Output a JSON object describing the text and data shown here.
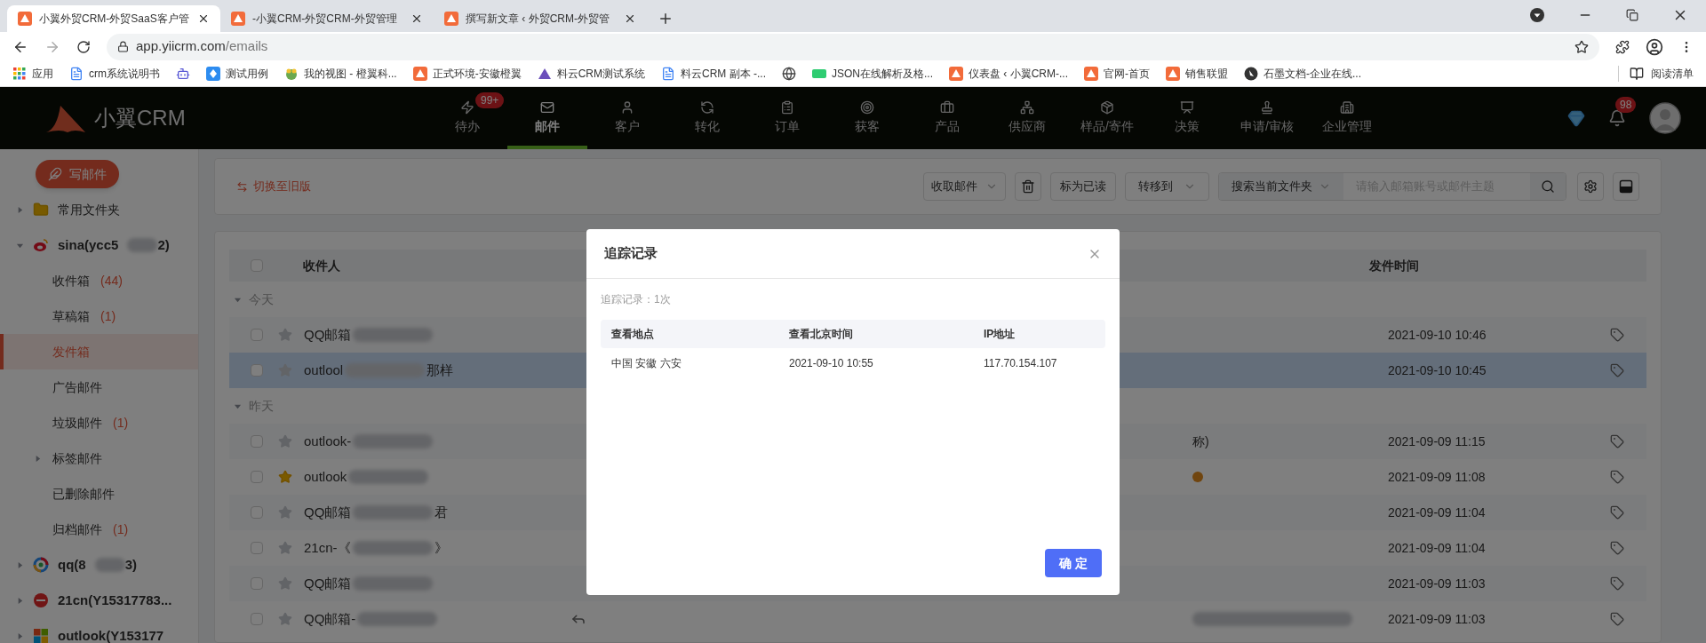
{
  "browser": {
    "tabs": [
      {
        "title": "小翼外贸CRM-外贸SaaS客户管",
        "selected": true
      },
      {
        "title": "-小翼CRM-外贸CRM-外贸管理",
        "selected": false
      },
      {
        "title": "撰写新文章 ‹ 外贸CRM-外贸管",
        "selected": false
      }
    ],
    "url_host": "app.yiicrm.com",
    "url_path": "/emails",
    "bookmarks": [
      {
        "kind": "apps",
        "label": "应用"
      },
      {
        "kind": "doc",
        "label": "crm系统说明书"
      },
      {
        "kind": "bot"
      },
      {
        "kind": "diamond",
        "label": "测试用例"
      },
      {
        "kind": "frog",
        "label": "我的视图 - 橙翼科..."
      },
      {
        "kind": "crm",
        "label": "正式环境-安徽橙翼"
      },
      {
        "kind": "triangle",
        "label": "料云CRM测试系统"
      },
      {
        "kind": "doc",
        "label": "料云CRM 副本 -..."
      },
      {
        "kind": "globe"
      },
      {
        "kind": "json",
        "label": "JSON在线解析及格..."
      },
      {
        "kind": "crm",
        "label": "仪表盘 ‹ 小翼CRM-..."
      },
      {
        "kind": "crm",
        "label": "官网-首页"
      },
      {
        "kind": "crm",
        "label": "销售联盟"
      },
      {
        "kind": "pen",
        "label": "石墨文档-企业在线..."
      }
    ],
    "reading_list": "阅读清单"
  },
  "app": {
    "logo": "小翼CRM",
    "nav": [
      {
        "label": "待办",
        "selected": false,
        "badge": "99+"
      },
      {
        "label": "邮件",
        "selected": true
      },
      {
        "label": "客户",
        "selected": false
      },
      {
        "label": "转化",
        "selected": false
      },
      {
        "label": "订单",
        "selected": false
      },
      {
        "label": "获客",
        "selected": false
      },
      {
        "label": "产品",
        "selected": false
      },
      {
        "label": "供应商",
        "selected": false
      },
      {
        "label": "样品/寄件",
        "selected": false
      },
      {
        "label": "决策",
        "selected": false
      },
      {
        "label": "申请/审核",
        "selected": false
      },
      {
        "label": "企业管理",
        "selected": false
      }
    ],
    "notifications": "98"
  },
  "sidebar": {
    "compose": "写邮件",
    "items": [
      {
        "kind": "folder",
        "label": "常用文件夹",
        "expanded": false
      },
      {
        "kind": "weibo",
        "label": "sina(ycc5",
        "tail": "2)",
        "expanded": true,
        "children": [
          {
            "label": "收件箱",
            "count": "(44)",
            "selected": false
          },
          {
            "label": "草稿箱",
            "count": "(1)",
            "selected": false
          },
          {
            "label": "发件箱",
            "selected": true
          },
          {
            "label": "广告邮件",
            "selected": false
          },
          {
            "label": "垃圾邮件",
            "count": "(1)",
            "selected": false
          },
          {
            "label": "标签邮件",
            "selected": false,
            "expanded": false
          },
          {
            "label": "已删除邮件",
            "selected": false
          },
          {
            "label": "归档邮件",
            "count": "(1)",
            "selected": false
          }
        ]
      },
      {
        "kind": "ring",
        "label": "qq(8",
        "tail": "3)",
        "expanded": false
      },
      {
        "kind": "disc",
        "label": "21cn(Y15317783...",
        "expanded": false
      },
      {
        "kind": "windows",
        "label": "outlook(Y153177",
        "expanded": false
      }
    ]
  },
  "toolbar": {
    "switch_link": "切换至旧版",
    "fetch": "收取邮件",
    "mark_read": "标为已读",
    "move_to": "转移到",
    "search_scope": "搜索当前文件夹",
    "search_placeholder": "请输入邮箱账号或邮件主题"
  },
  "table": {
    "columns": [
      "收件人",
      "发件时间"
    ],
    "all_checked": false,
    "groups": [
      {
        "label": "今天",
        "expanded": true,
        "rows": [
          {
            "recipient": "QQ邮箱",
            "checked": false,
            "starred": false,
            "selected": false,
            "time": "2021-09-10 10:46"
          },
          {
            "recipient": "outlool",
            "tail": "那样",
            "checked": false,
            "starred": false,
            "selected": true,
            "time": "2021-09-10 10:45"
          }
        ]
      },
      {
        "label": "昨天",
        "expanded": true,
        "rows": [
          {
            "recipient": "outlook-",
            "subject": "称)",
            "checked": false,
            "starred": false,
            "selected": false,
            "time": "2021-09-09 11:15"
          },
          {
            "recipient": "outlook",
            "checked": false,
            "starred": true,
            "selected": false,
            "dot": true,
            "time": "2021-09-09 11:08"
          },
          {
            "recipient": "QQ邮箱",
            "tail": "君",
            "checked": false,
            "starred": false,
            "selected": false,
            "time": "2021-09-09 11:04"
          },
          {
            "recipient": "21cn-《",
            "tail": "》",
            "checked": false,
            "starred": false,
            "selected": false,
            "time": "2021-09-09 11:04"
          },
          {
            "recipient": "QQ邮箱",
            "checked": false,
            "starred": false,
            "selected": false,
            "time": "2021-09-09 11:03"
          },
          {
            "recipient": "QQ邮箱-",
            "checked": false,
            "starred": false,
            "selected": false,
            "replied": true,
            "time": "2021-09-09 11:03"
          }
        ]
      }
    ]
  },
  "dialog": {
    "title": "追踪记录",
    "summary": "追踪记录：1次",
    "columns": [
      "查看地点",
      "查看北京时间",
      "IP地址"
    ],
    "rows": [
      [
        "中国 安徽 六安",
        "2021-09-10 10:55",
        "117.70.154.107"
      ]
    ],
    "confirm": "确 定"
  }
}
